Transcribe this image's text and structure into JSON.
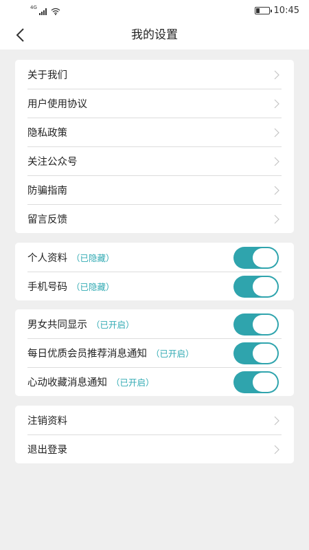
{
  "status_bar": {
    "network": "4G",
    "time": "10:45",
    "battery_level": 0.3,
    "icons": [
      "signal-icon",
      "wifi-icon",
      "battery-icon"
    ]
  },
  "nav": {
    "back_icon": "chevron-left-icon",
    "title": "我的设置"
  },
  "section_info": {
    "items": [
      {
        "label": "关于我们"
      },
      {
        "label": "用户使用协议"
      },
      {
        "label": "隐私政策"
      },
      {
        "label": "关注公众号"
      },
      {
        "label": "防骗指南"
      },
      {
        "label": "留言反馈"
      }
    ]
  },
  "section_privacy": {
    "items": [
      {
        "label": "个人资料",
        "note": "（已隐藏）",
        "enabled": true
      },
      {
        "label": "手机号码",
        "note": "（已隐藏）",
        "enabled": true
      }
    ]
  },
  "section_notify": {
    "items": [
      {
        "label": "男女共同显示",
        "note": "（已开启）",
        "enabled": true
      },
      {
        "label": "每日优质会员推荐消息通知",
        "note": "（已开启）",
        "enabled": true
      },
      {
        "label": "心动收藏消息通知",
        "note": "（已开启）",
        "enabled": true
      }
    ]
  },
  "section_account": {
    "items": [
      {
        "label": "注销资料"
      },
      {
        "label": "退出登录"
      }
    ]
  },
  "colors": {
    "accent": "#2fa4ad",
    "note_text": "#31aab3",
    "background": "#efefef"
  }
}
